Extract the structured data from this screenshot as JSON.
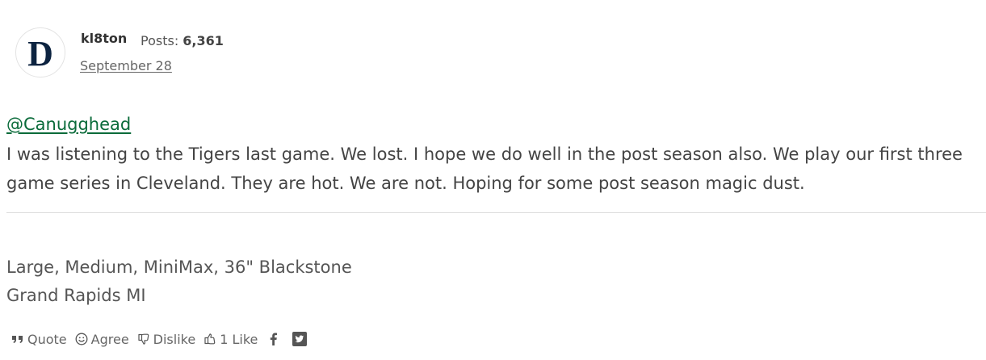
{
  "post": {
    "author": "kl8ton",
    "posts_label": "Posts:",
    "posts_count": "6,361",
    "date": "September 28",
    "mention": "@Canugghead",
    "body": "I was listening to the Tigers last game.  We lost.  I hope we do well in the post season also.  We play our first three game series in Cleveland.  They are hot.  We are not.  Hoping for some post season magic dust."
  },
  "signature": {
    "line1": "Large, Medium, MiniMax, 36\" Blackstone",
    "line2": "Grand Rapids MI"
  },
  "actions": {
    "quote": "Quote",
    "agree": "Agree",
    "dislike": "Dislike",
    "like_count": "1",
    "like": "Like"
  },
  "icons": [
    "quote-icon",
    "smile-icon",
    "thumbs-down-icon",
    "thumbs-up-icon",
    "facebook-icon",
    "twitter-icon"
  ],
  "colors": {
    "link": "#0a6b3a",
    "avatar_logo": "#0c2340"
  }
}
